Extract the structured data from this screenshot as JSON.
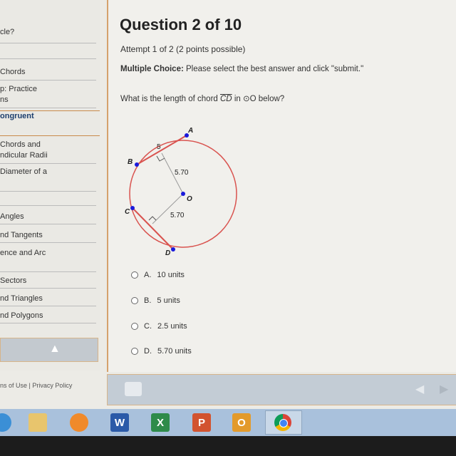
{
  "sidebar": {
    "items": [
      "cle?",
      "",
      "Chords",
      "p: Practice\nns",
      "ongruent\n",
      "Chords and\nndicular Radii",
      "Diameter of a\n",
      "",
      "Angles",
      "nd Tangents",
      "ence and Arc\n",
      "Sectors",
      "nd Triangles",
      "nd Polygons"
    ]
  },
  "footer": {
    "terms": "ns of Use",
    "sep": "|",
    "privacy": "Privacy Policy"
  },
  "question": {
    "title": "Question 2 of 10",
    "attempt": "Attempt 1 of 2 (2 points possible)",
    "instr_bold": "Multiple Choice:",
    "instr": " Please select the best answer and click \"submit.\"",
    "text_pre": "What is the length of chord ",
    "chord": "CD",
    "text_mid": " in ",
    "circle_symbol": "⊙",
    "text_post": "O below?"
  },
  "diagram": {
    "labels": {
      "A": "A",
      "B": "B",
      "C": "C",
      "D": "D",
      "O": "O"
    },
    "ab_half": "5",
    "dist1": "5.70",
    "dist2": "5.70",
    "circle_color": "#d9534f",
    "point_color": "#1a1adb"
  },
  "options": [
    {
      "letter": "A.",
      "text": "10 units"
    },
    {
      "letter": "B.",
      "text": "5 units"
    },
    {
      "letter": "C.",
      "text": "2.5 units"
    },
    {
      "letter": "D.",
      "text": "5.70 units"
    }
  ],
  "taskbar": {
    "apps": [
      "ie-icon",
      "explorer-icon",
      "media-player-icon",
      "word-icon",
      "excel-icon",
      "powerpoint-icon",
      "outlook-icon",
      "chrome-icon"
    ],
    "word": "W",
    "excel": "X",
    "ppt": "P",
    "outlook": "O"
  }
}
